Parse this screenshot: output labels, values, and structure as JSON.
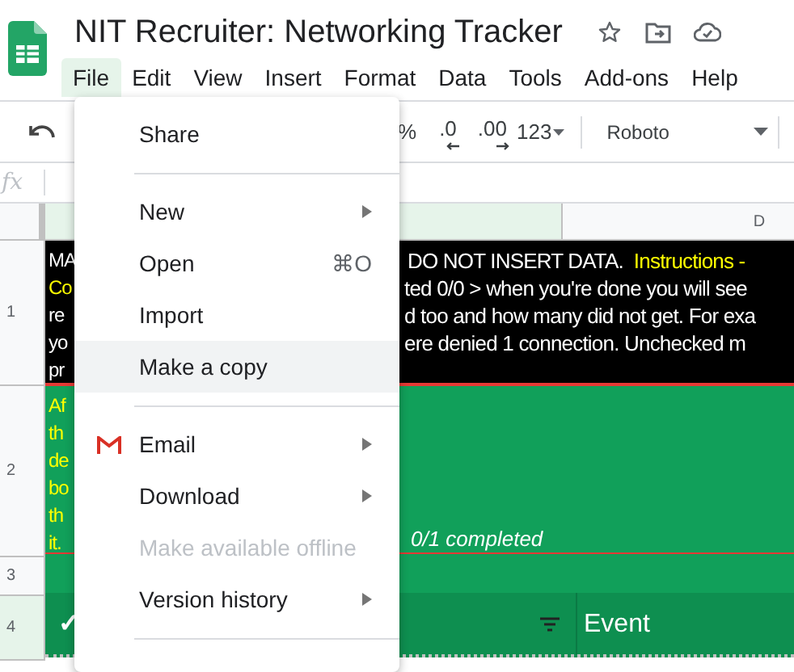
{
  "window": {
    "title": "NIT Recruiter: Networking Tracker"
  },
  "menu_bar": [
    {
      "label": "File",
      "selected": true
    },
    {
      "label": "Edit",
      "selected": false
    },
    {
      "label": "View",
      "selected": false
    },
    {
      "label": "Insert",
      "selected": false
    },
    {
      "label": "Format",
      "selected": false
    },
    {
      "label": "Data",
      "selected": false
    },
    {
      "label": "Tools",
      "selected": false
    },
    {
      "label": "Add-ons",
      "selected": false
    },
    {
      "label": "Help",
      "selected": false
    }
  ],
  "toolbar": {
    "percent": "%",
    "decrease_decimals": ".0",
    "increase_decimals": ".00",
    "number_format": "123",
    "font": "Roboto"
  },
  "formula_bar": {
    "label": "fx"
  },
  "column_headers": [
    {
      "label": "D"
    }
  ],
  "row_headers": [
    {
      "label": "1",
      "selected": false
    },
    {
      "label": "2",
      "selected": false
    },
    {
      "label": "3",
      "selected": false
    },
    {
      "label": "4",
      "selected": true
    }
  ],
  "row_1": {
    "left_lines": [
      {
        "text": "MA",
        "color": "#ffffff"
      },
      {
        "text": "Co",
        "color": "#ffff00"
      },
      {
        "text": "re",
        "color": "#ffffff"
      },
      {
        "text": "yo",
        "color": "#ffffff"
      },
      {
        "text": "pr",
        "color": "#ffffff"
      }
    ],
    "right_lines": [
      [
        {
          "text": "DO NOT INSERT DATA.  ",
          "color": "#ffffff"
        },
        {
          "text": "Instructions -",
          "color": "#ffff00"
        }
      ],
      [
        {
          "text": "ted 0/0 > when you're done you will see",
          "color": "#ffffff"
        }
      ],
      [
        {
          "text": "d too and how many did not get. For exa",
          "color": "#ffffff"
        }
      ],
      [
        {
          "text": "ere denied 1 connection. Unchecked m",
          "color": "#ffffff"
        }
      ]
    ]
  },
  "row_2": {
    "left_lines": [
      "Af",
      "th",
      "de",
      "bo",
      "th",
      "it."
    ],
    "status": "0/1 completed"
  },
  "row_4": {
    "check": "✓",
    "column_2": "Event"
  },
  "file_menu": [
    {
      "kind": "item",
      "label": "Share",
      "submenu": false,
      "disabled": false,
      "selected": false
    },
    {
      "kind": "separator"
    },
    {
      "kind": "item",
      "label": "New",
      "submenu": true,
      "disabled": false,
      "selected": false
    },
    {
      "kind": "item",
      "label": "Open",
      "shortcut": "⌘O",
      "submenu": false,
      "disabled": false,
      "selected": false
    },
    {
      "kind": "item",
      "label": "Import",
      "submenu": false,
      "disabled": false,
      "selected": false
    },
    {
      "kind": "item",
      "label": "Make a copy",
      "submenu": false,
      "disabled": false,
      "selected": true
    },
    {
      "kind": "separator"
    },
    {
      "kind": "mail",
      "label": "Email",
      "submenu": true,
      "disabled": false,
      "selected": false
    },
    {
      "kind": "item",
      "label": "Download",
      "submenu": true,
      "disabled": false,
      "selected": false
    },
    {
      "kind": "item",
      "label": "Make available offline",
      "submenu": false,
      "disabled": true,
      "selected": false
    },
    {
      "kind": "item",
      "label": "Version history",
      "submenu": true,
      "disabled": false,
      "selected": false
    },
    {
      "kind": "separator"
    }
  ]
}
